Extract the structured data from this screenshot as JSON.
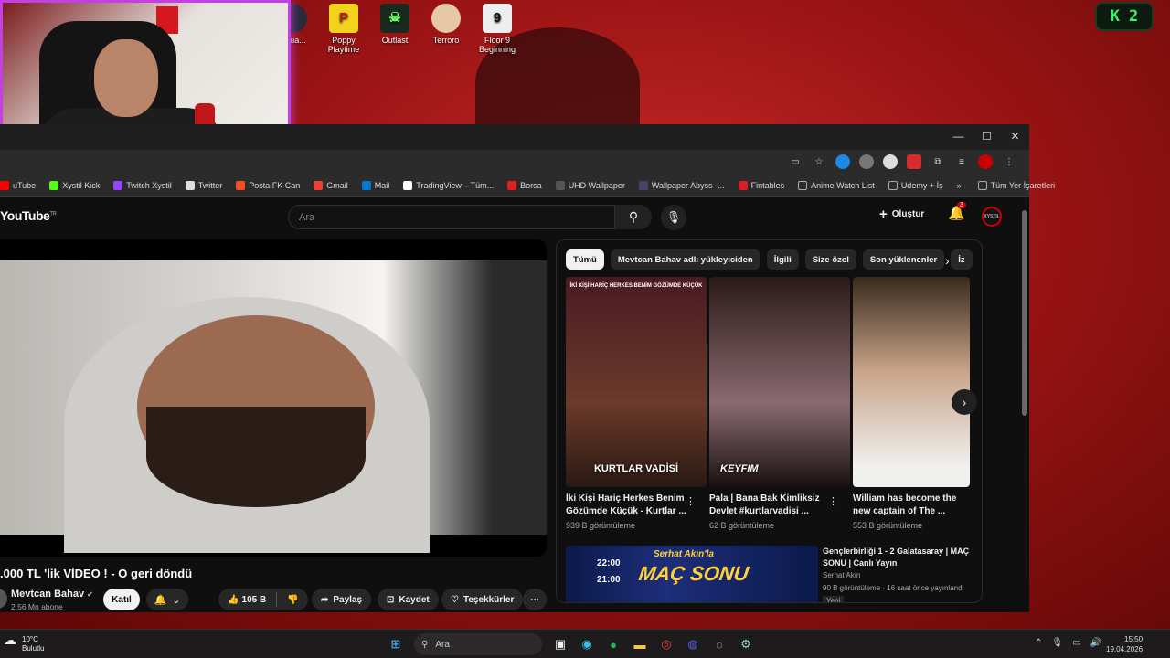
{
  "desktop": {
    "icons": [
      {
        "label": "...cua...",
        "color": "#2a2a3a"
      },
      {
        "label": "Poppy Playtime",
        "color": "#f3d21b"
      },
      {
        "label": "Outlast",
        "color": "#1a2a1f"
      },
      {
        "label": "Terroro",
        "color": "#e6c7a6"
      },
      {
        "label": "Floor 9 Beginning",
        "color": "#222222"
      }
    ],
    "badge_k": "K",
    "badge_count": "2"
  },
  "browser": {
    "controls": {
      "minimize": "—",
      "maximize": "☐",
      "close": "✕"
    },
    "bookmarks": [
      {
        "label": "uTube",
        "color": "#ff0000"
      },
      {
        "label": "Xystil Kick",
        "color": "#53fc18"
      },
      {
        "label": "Twitch Xystil",
        "color": "#9146ff"
      },
      {
        "label": "Twitter",
        "color": "#dddddd"
      },
      {
        "label": "Posta FK Can",
        "color": "#f25022"
      },
      {
        "label": "Gmail",
        "color": "#ea4335"
      },
      {
        "label": "Mail",
        "color": "#0078d4"
      },
      {
        "label": "TradingView – Tüm...",
        "color": "#ffffff"
      },
      {
        "label": "Borsa",
        "color": "#e02020"
      },
      {
        "label": "UHD Wallpaper",
        "color": "#555555"
      },
      {
        "label": "Wallpaper Abyss -...",
        "color": "#444466"
      },
      {
        "label": "Fintables",
        "color": "#d61f26"
      },
      {
        "label": "Anime Watch List",
        "color": "#888888"
      },
      {
        "label": "Udemy + İş",
        "color": "#888888"
      }
    ],
    "bookmarks_more": "»",
    "all_bookmarks": "Tüm Yer İşaretleri"
  },
  "youtube": {
    "logo": "YouTube",
    "region": "TR",
    "search_placeholder": "Ara",
    "create": "Oluştur",
    "notifications": "3",
    "avatar_text": "XYSTIL",
    "video": {
      "title": ".000 TL 'lik VİDEO ! - O geri döndü",
      "channel": "Mevtcan Bahav",
      "verified": "✔",
      "subscribers": "2,56 Mn abone",
      "join": "Katıl",
      "likes": "105 B",
      "share": "Paylaş",
      "save": "Kaydet",
      "thanks": "Teşekkürler",
      "more": "⋯"
    },
    "chips": [
      "Tümü",
      "Mevtcan Bahav adlı yükleyiciden",
      "İlgili",
      "Size özel",
      "Son yüklenenler",
      "İz"
    ],
    "cards": [
      {
        "title": "İki Kişi Hariç Herkes Benim Gözümde Küçük - Kurtlar ...",
        "meta": "939 B görüntüleme",
        "caption": "KURTLAR VADİSİ",
        "top_caption": "İKİ KİŞİ HARİÇ HERKES BENİM GÖZÜMDE KÜÇÜK",
        "color1": "#4a1a22",
        "color2": "#6b3a2a"
      },
      {
        "title": "Pala | Bana Bak Kimliksiz Devlet  #kurtlarvadisi ...",
        "meta": "62 B görüntüleme",
        "caption": "KEYFIM",
        "top_caption": "",
        "color1": "#2c1a1a",
        "color2": "#8a6a70"
      },
      {
        "title": "William has become the new captain of The ...",
        "meta": "553 B görüntüleme",
        "caption": "",
        "top_caption": "",
        "color1": "#3a2a1c",
        "color2": "#c9a48a"
      }
    ],
    "live": {
      "title": "Gençlerbirliği 1 - 2 Galatasaray | MAÇ SONU | Canlı Yayın",
      "channel": "Serhat Akın",
      "meta": "90 B görüntüleme · 16 saat önce yayınlandı",
      "badge": "Yeni",
      "time1": "22:00",
      "time2": "21:00",
      "banner": "MAÇ SONU",
      "banner_sub": "Serhat Akın'la"
    }
  },
  "taskbar": {
    "temp": "10°C",
    "weather": "Bulutlu",
    "search": "Ara",
    "time": "15:50",
    "date": "19.04.2026"
  }
}
